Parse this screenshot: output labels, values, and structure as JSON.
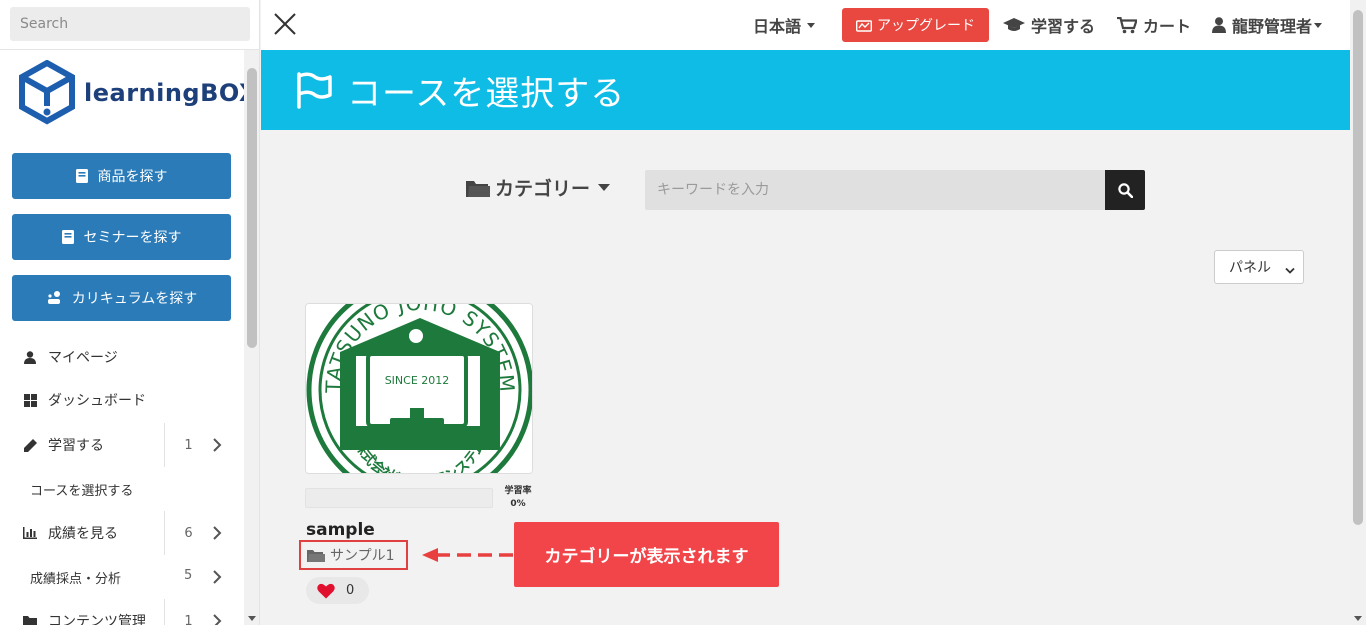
{
  "sidebar": {
    "search_placeholder": "Search",
    "logo_text": "learningBOX",
    "buttons": [
      {
        "label": "商品を探す",
        "icon": "book-icon"
      },
      {
        "label": "セミナーを探す",
        "icon": "book-icon"
      },
      {
        "label": "カリキュラムを探す",
        "icon": "curriculum-icon"
      }
    ],
    "menu": [
      {
        "label": "マイページ",
        "icon": "user-icon"
      },
      {
        "label": "ダッシュボード",
        "icon": "dashboard-icon"
      },
      {
        "label": "学習する",
        "icon": "pencil-icon",
        "count": "1"
      },
      {
        "label": "コースを選択する",
        "sub": true
      },
      {
        "label": "成績を見る",
        "icon": "chart-icon",
        "count": "6"
      },
      {
        "label": "成績採点・分析",
        "sub": true,
        "count": "5"
      },
      {
        "label": "コンテンツ管理",
        "icon": "folder-icon",
        "count": "1"
      }
    ]
  },
  "topbar": {
    "language": "日本語",
    "upgrade_label": "アップグレード",
    "learn_label": "学習する",
    "cart_label": "カート",
    "user_label": "龍野管理者"
  },
  "banner": {
    "title": "コースを選択する"
  },
  "filter": {
    "category_label": "カテゴリー",
    "keyword_placeholder": "キーワードを入力",
    "view_option": "パネル"
  },
  "course": {
    "title": "sample",
    "category": "サンプル1",
    "progress_label": "学習率",
    "progress_value": "0%",
    "progress_fraction": 0,
    "likes": "0",
    "logo_ring_text": "TATSUNO JOHO SYSTEM",
    "logo_since": "SINCE 2012",
    "logo_bottom_text": "株式会社龍野情報システム"
  },
  "annotation": {
    "text": "カテゴリーが表示されます"
  },
  "colors": {
    "banner": "#0ebce5",
    "sidebar_button": "#2b7bb9",
    "upgrade": "#e8483f",
    "annotation": "#f2454a",
    "logo_green": "#1e7a3c"
  }
}
